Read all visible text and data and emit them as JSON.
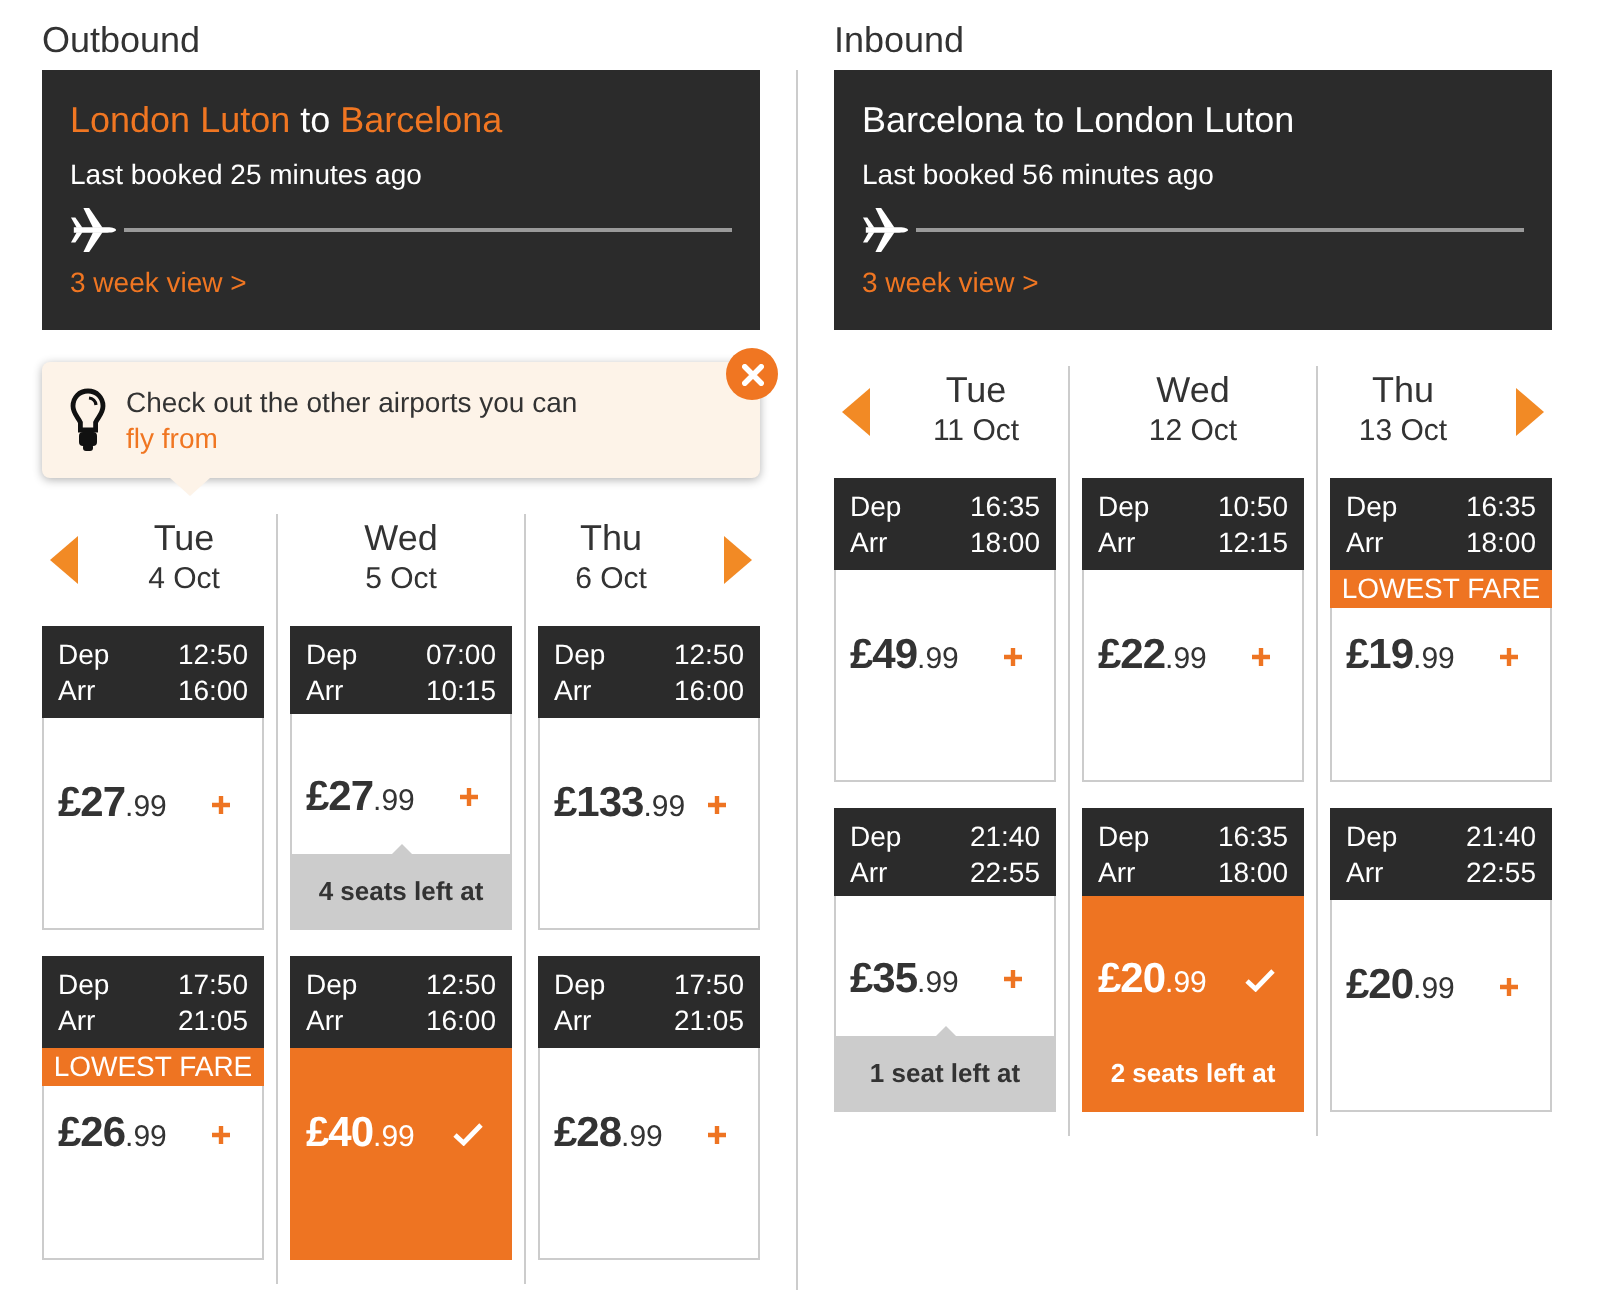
{
  "sections": [
    {
      "heading": "Outbound",
      "route": {
        "origin": "London Luton",
        "connector": "to",
        "destination": "Barcelona",
        "highlighted": true
      },
      "last_booked": "Last booked 25 minutes ago",
      "week_view_link": "3 week view >",
      "tip": {
        "text": "Check out the other airports you can",
        "link": "fly from"
      },
      "days": [
        {
          "day": "Tue",
          "date": "4 Oct",
          "flights": [
            {
              "dep_label": "Dep",
              "dep_time": "12:50",
              "arr_label": "Arr",
              "arr_time": "16:00",
              "price": "£27",
              "pence": ".99",
              "selected": false
            },
            {
              "dep_label": "Dep",
              "dep_time": "17:50",
              "arr_label": "Arr",
              "arr_time": "21:05",
              "badge": "LOWEST FARE",
              "price": "£26",
              "pence": ".99",
              "selected": false
            }
          ]
        },
        {
          "day": "Wed",
          "date": "5 Oct",
          "flights": [
            {
              "dep_label": "Dep",
              "dep_time": "07:00",
              "arr_label": "Arr",
              "arr_time": "10:15",
              "price": "£27",
              "pence": ".99",
              "seats_note": "4 seats left at",
              "selected": false
            },
            {
              "dep_label": "Dep",
              "dep_time": "12:50",
              "arr_label": "Arr",
              "arr_time": "16:00",
              "price": "£40",
              "pence": ".99",
              "selected": true
            }
          ]
        },
        {
          "day": "Thu",
          "date": "6 Oct",
          "flights": [
            {
              "dep_label": "Dep",
              "dep_time": "12:50",
              "arr_label": "Arr",
              "arr_time": "16:00",
              "price": "£133",
              "pence": ".99",
              "selected": false
            },
            {
              "dep_label": "Dep",
              "dep_time": "17:50",
              "arr_label": "Arr",
              "arr_time": "21:05",
              "price": "£28",
              "pence": ".99",
              "selected": false
            }
          ]
        }
      ]
    },
    {
      "heading": "Inbound",
      "route": {
        "origin": "Barcelona",
        "connector": "to",
        "destination": "London Luton",
        "highlighted": false
      },
      "last_booked": "Last booked 56 minutes ago",
      "week_view_link": "3 week view >",
      "days": [
        {
          "day": "Tue",
          "date": "11 Oct",
          "flights": [
            {
              "dep_label": "Dep",
              "dep_time": "16:35",
              "arr_label": "Arr",
              "arr_time": "18:00",
              "price": "£49",
              "pence": ".99",
              "selected": false
            },
            {
              "dep_label": "Dep",
              "dep_time": "21:40",
              "arr_label": "Arr",
              "arr_time": "22:55",
              "price": "£35",
              "pence": ".99",
              "seats_note": "1 seat left at",
              "selected": false
            }
          ]
        },
        {
          "day": "Wed",
          "date": "12 Oct",
          "flights": [
            {
              "dep_label": "Dep",
              "dep_time": "10:50",
              "arr_label": "Arr",
              "arr_time": "12:15",
              "price": "£22",
              "pence": ".99",
              "selected": false
            },
            {
              "dep_label": "Dep",
              "dep_time": "16:35",
              "arr_label": "Arr",
              "arr_time": "18:00",
              "price": "£20",
              "pence": ".99",
              "seats_note": "2 seats left at",
              "selected": true
            }
          ]
        },
        {
          "day": "Thu",
          "date": "13 Oct",
          "flights": [
            {
              "dep_label": "Dep",
              "dep_time": "16:35",
              "arr_label": "Arr",
              "arr_time": "18:00",
              "badge": "LOWEST FARE",
              "price": "£19",
              "pence": ".99",
              "selected": false
            },
            {
              "dep_label": "Dep",
              "dep_time": "21:40",
              "arr_label": "Arr",
              "arr_time": "22:55",
              "price": "£20",
              "pence": ".99",
              "selected": false
            }
          ]
        }
      ]
    }
  ]
}
